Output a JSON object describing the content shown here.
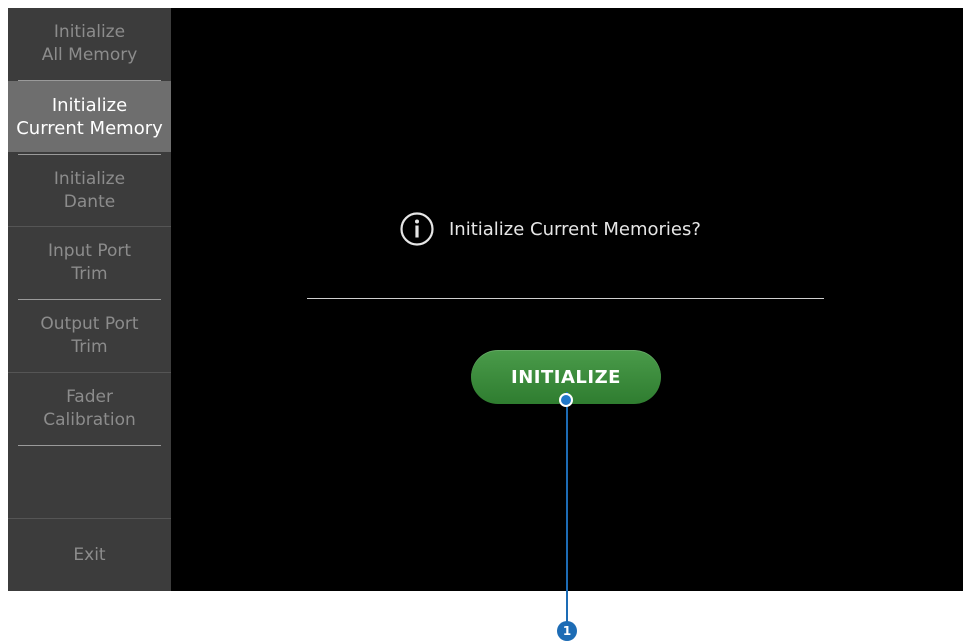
{
  "sidebar": {
    "items": [
      {
        "label": "Initialize\nAll Memory",
        "selected": false
      },
      {
        "label": "Initialize\nCurrent Memory",
        "selected": true
      },
      {
        "label": "Initialize\nDante",
        "selected": false
      },
      {
        "label": "Input Port\nTrim",
        "selected": false
      },
      {
        "label": "Output Port\nTrim",
        "selected": false
      },
      {
        "label": "Fader\nCalibration",
        "selected": false
      }
    ],
    "exit_label": "Exit"
  },
  "main": {
    "prompt_icon": "info-icon",
    "prompt_text": "Initialize Current Memories?",
    "button_label": "INITIALIZE"
  },
  "callout": {
    "number": "1"
  },
  "colors": {
    "screen_bg": "#000000",
    "sidebar_bg": "#3c3c3c",
    "selected_bg": "#6e6e6e",
    "button_green": "#2f7d30",
    "callout_blue": "#1d6cb5"
  }
}
